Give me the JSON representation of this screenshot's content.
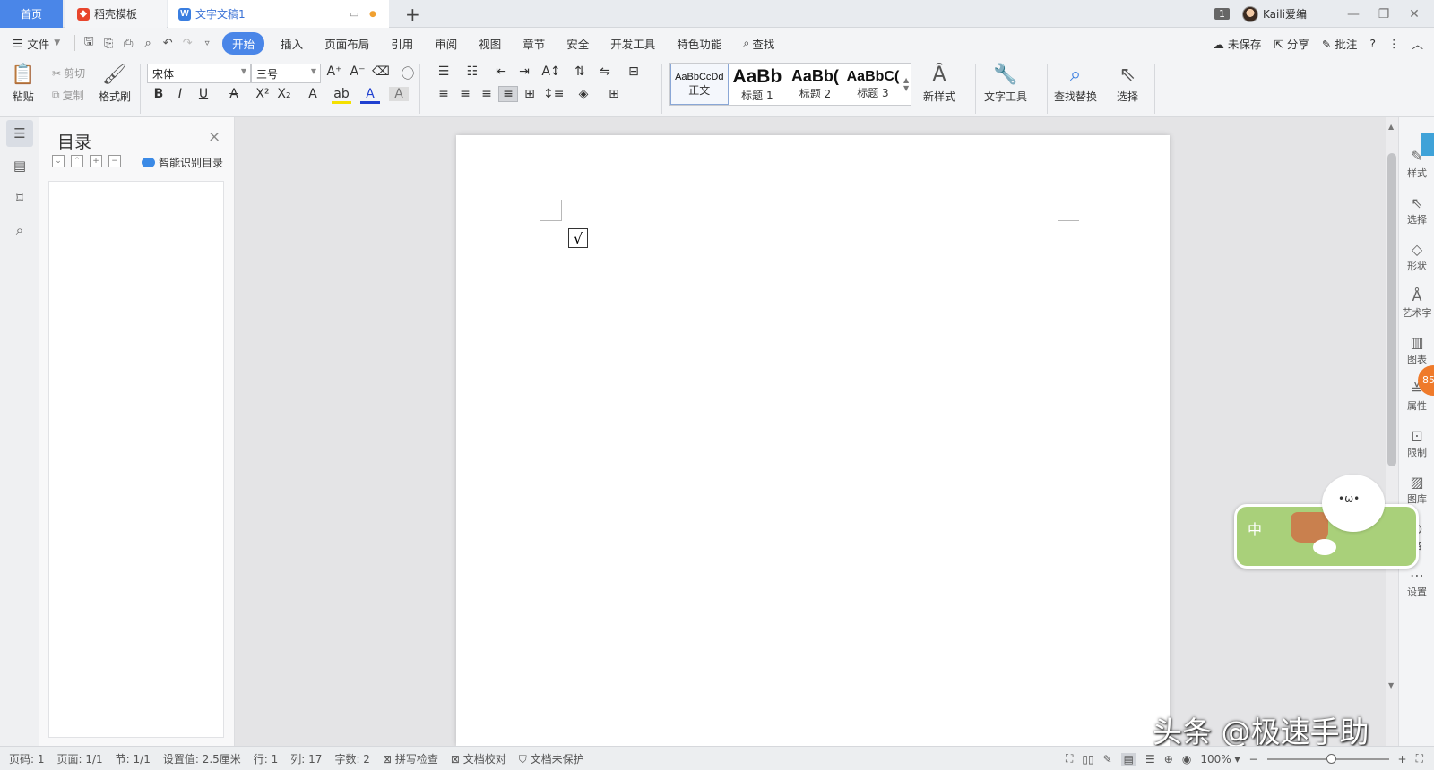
{
  "tabs": {
    "home": "首页",
    "template": "稻壳模板",
    "doc": "文字文稿1",
    "doc_dot": "●",
    "new_tab": "+"
  },
  "titlebar": {
    "window_count": "1",
    "user": "Kaili爱编",
    "minimize": "—",
    "restore": "❐",
    "close": "✕"
  },
  "menu": {
    "file": "文件",
    "items": [
      "开始",
      "插入",
      "页面布局",
      "引用",
      "审阅",
      "视图",
      "章节",
      "安全",
      "开发工具",
      "特色功能"
    ],
    "search": "查找",
    "unsaved": "未保存",
    "share": "分享",
    "comment": "批注",
    "help": "?",
    "more": "⋮",
    "collapse": "︿"
  },
  "ribbon": {
    "paste": "粘贴",
    "cut": "剪切",
    "copy": "复制",
    "format_painter": "格式刷",
    "font_name": "宋体",
    "font_size": "三号",
    "styles": [
      {
        "preview": "AaBbCcDd",
        "name": "正文"
      },
      {
        "preview": "AaBb",
        "name": "标题 1"
      },
      {
        "preview": "AaBb(",
        "name": "标题 2"
      },
      {
        "preview": "AaBbC(",
        "name": "标题 3"
      }
    ],
    "new_style": "新样式",
    "text_tools": "文字工具",
    "find_replace": "查找替换",
    "select": "选择"
  },
  "toc": {
    "title": "目录",
    "close": "×",
    "smart_toc": "智能识别目录"
  },
  "document": {
    "checkbox_mark": "√"
  },
  "right_panel": [
    "样式",
    "选择",
    "形状",
    "艺术字",
    "图表",
    "属性",
    "限制",
    "图库",
    "格",
    "设置"
  ],
  "widget": {
    "label": "中",
    "face": "•ω•",
    "badge": "85"
  },
  "watermark": "头条 @极速手助",
  "status": {
    "page_code": "页码: 1",
    "page": "页面: 1/1",
    "section": "节: 1/1",
    "setting": "设置值: 2.5厘米",
    "row": "行: 1",
    "col": "列: 17",
    "word_count": "字数: 2",
    "spell_check": "拼写检查",
    "doc_proof": "文档校对",
    "doc_unprotected": "文档未保护",
    "zoom": "100%"
  },
  "colors": {
    "accent": "#4a86e8",
    "page": "#ffffff",
    "workspace": "#e4e4e6",
    "widget_green": "#a9d07a"
  }
}
